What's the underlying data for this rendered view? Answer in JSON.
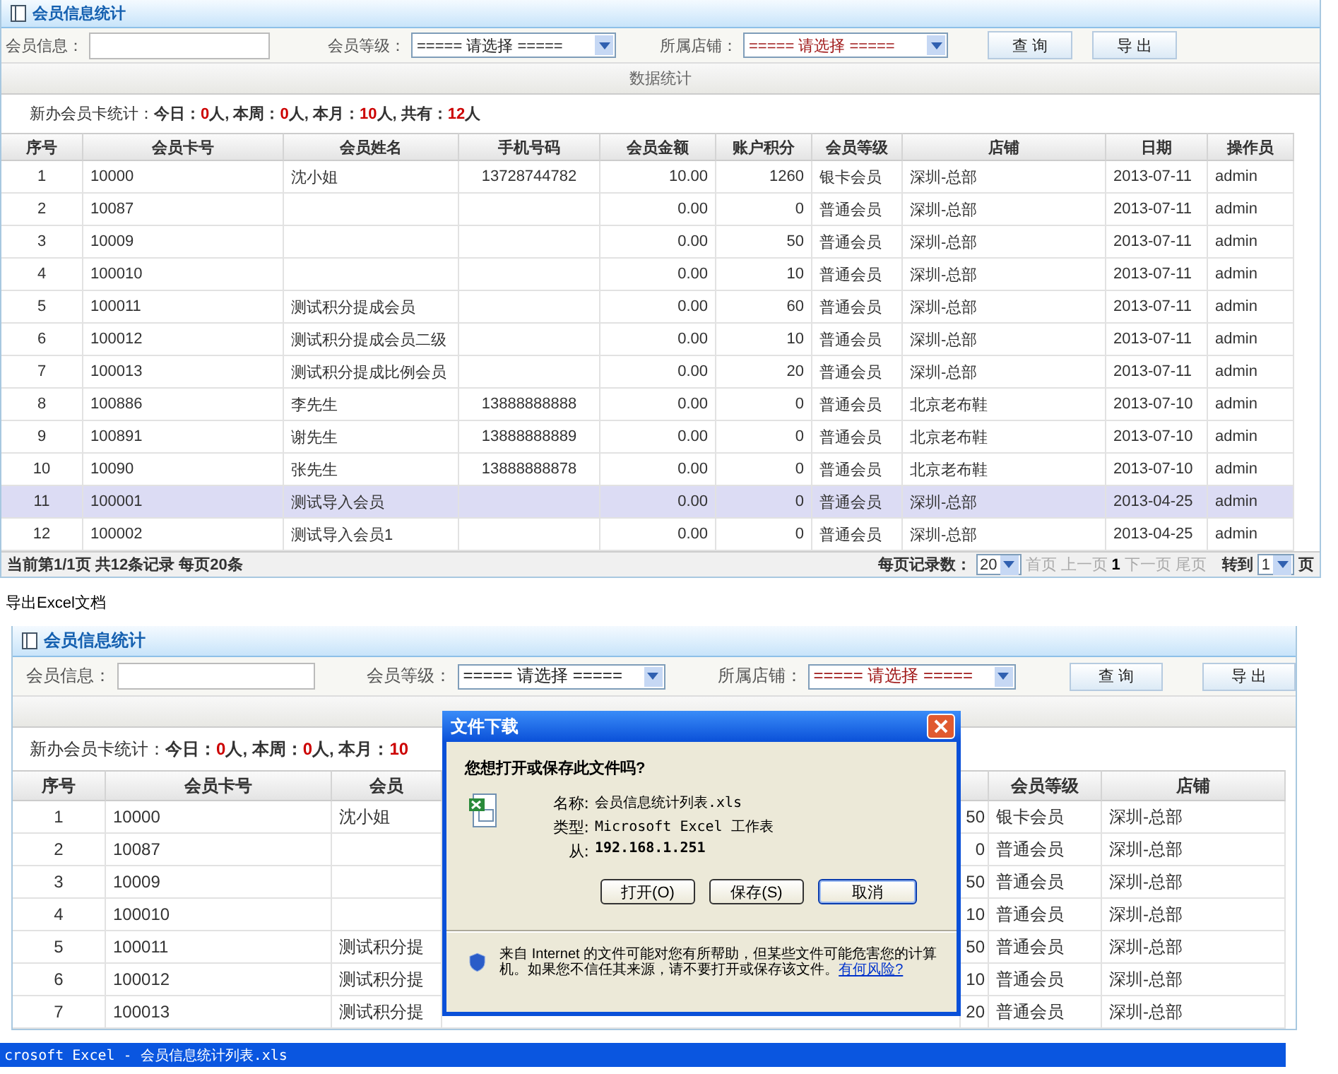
{
  "top_panel": {
    "title": "会员信息统计",
    "filters": [
      {
        "label": "会员信息：",
        "kind": "input"
      },
      {
        "label": "会员等级：",
        "kind": "select",
        "value": "===== 请选择 =====",
        "color": "#222222"
      },
      {
        "label": "所属店铺：",
        "kind": "select",
        "value": "===== 请选择 =====",
        "color": "#a01818"
      }
    ],
    "buttons": [
      "查 询",
      "导 出"
    ],
    "stats_bar": "数据统计",
    "summary": [
      {
        "text": "新办会员卡统计：",
        "kind": "plain"
      },
      {
        "text": "今日：",
        "kind": "key"
      },
      {
        "text": "0",
        "kind": "count"
      },
      {
        "text": "人, 本周：",
        "kind": "key"
      },
      {
        "text": "0",
        "kind": "count"
      },
      {
        "text": "人, 本月：",
        "kind": "key"
      },
      {
        "text": "10",
        "kind": "count"
      },
      {
        "text": "人, 共有：",
        "kind": "key"
      },
      {
        "text": "12",
        "kind": "count"
      },
      {
        "text": "人",
        "kind": "key"
      }
    ],
    "columns": [
      "序号",
      "会员卡号",
      "会员姓名",
      "手机号码",
      "会员金额",
      "账户积分",
      "会员等级",
      "店铺",
      "日期",
      "操作员"
    ],
    "rows": [
      {
        "selected": false,
        "cells": [
          "1",
          "10000",
          "沈小姐",
          "13728744782",
          "10.00",
          "1260",
          "银卡会员",
          "深圳-总部",
          "2013-07-11",
          "admin"
        ]
      },
      {
        "selected": false,
        "cells": [
          "2",
          "10087",
          "",
          "",
          "0.00",
          "0",
          "普通会员",
          "深圳-总部",
          "2013-07-11",
          "admin"
        ]
      },
      {
        "selected": false,
        "cells": [
          "3",
          "10009",
          "",
          "",
          "0.00",
          "50",
          "普通会员",
          "深圳-总部",
          "2013-07-11",
          "admin"
        ]
      },
      {
        "selected": false,
        "cells": [
          "4",
          "100010",
          "",
          "",
          "0.00",
          "10",
          "普通会员",
          "深圳-总部",
          "2013-07-11",
          "admin"
        ]
      },
      {
        "selected": false,
        "cells": [
          "5",
          "100011",
          "测试积分提成会员",
          "",
          "0.00",
          "60",
          "普通会员",
          "深圳-总部",
          "2013-07-11",
          "admin"
        ]
      },
      {
        "selected": false,
        "cells": [
          "6",
          "100012",
          "测试积分提成会员二级",
          "",
          "0.00",
          "10",
          "普通会员",
          "深圳-总部",
          "2013-07-11",
          "admin"
        ]
      },
      {
        "selected": false,
        "cells": [
          "7",
          "100013",
          "测试积分提成比例会员",
          "",
          "0.00",
          "20",
          "普通会员",
          "深圳-总部",
          "2013-07-11",
          "admin"
        ]
      },
      {
        "selected": false,
        "cells": [
          "8",
          "100886",
          "李先生",
          "13888888888",
          "0.00",
          "0",
          "普通会员",
          "北京老布鞋",
          "2013-07-10",
          "admin"
        ]
      },
      {
        "selected": false,
        "cells": [
          "9",
          "100891",
          "谢先生",
          "13888888889",
          "0.00",
          "0",
          "普通会员",
          "北京老布鞋",
          "2013-07-10",
          "admin"
        ]
      },
      {
        "selected": false,
        "cells": [
          "10",
          "10090",
          "张先生",
          "13888888878",
          "0.00",
          "0",
          "普通会员",
          "北京老布鞋",
          "2013-07-10",
          "admin"
        ]
      },
      {
        "selected": true,
        "cells": [
          "11",
          "100001",
          "测试导入会员",
          "",
          "0.00",
          "0",
          "普通会员",
          "深圳-总部",
          "2013-04-25",
          "admin"
        ]
      },
      {
        "selected": false,
        "cells": [
          "12",
          "100002",
          "测试导入会员1",
          "",
          "0.00",
          "0",
          "普通会员",
          "深圳-总部",
          "2013-04-25",
          "admin"
        ]
      }
    ],
    "footer": {
      "info": "当前第1/1页 共12条记录 每页20条",
      "per_page_label": "每页记录数：",
      "per_page": "20",
      "pager": [
        {
          "text": "首页",
          "disabled": true
        },
        {
          "text": "上一页",
          "disabled": true
        },
        {
          "text": "1",
          "disabled": false
        },
        {
          "text": "下一页",
          "disabled": true
        },
        {
          "text": "尾页",
          "disabled": true
        }
      ],
      "goto_label": "转到",
      "goto_page": "1",
      "page_unit": "页"
    }
  },
  "caption": "导出Excel文档",
  "bottom_panel": {
    "title": "会员信息统计",
    "filters": [
      {
        "label": "会员信息：",
        "kind": "input"
      },
      {
        "label": "会员等级：",
        "kind": "select",
        "value": "===== 请选择 =====",
        "color": "#222222"
      },
      {
        "label": "所属店铺：",
        "kind": "select",
        "value": "===== 请选择 =====",
        "color": "#a01818"
      }
    ],
    "buttons": [
      "查 询",
      "导 出"
    ],
    "summary": [
      {
        "text": "新办会员卡统计：",
        "kind": "plain"
      },
      {
        "text": "今日：",
        "kind": "key"
      },
      {
        "text": "0",
        "kind": "count"
      },
      {
        "text": "人, 本周：",
        "kind": "key"
      },
      {
        "text": "0",
        "kind": "count"
      },
      {
        "text": "人, 本月：",
        "kind": "key"
      },
      {
        "text": "10",
        "kind": "count"
      }
    ],
    "columns": [
      "序号",
      "会员卡号",
      "会员",
      "",
      "会员等级",
      "店铺"
    ],
    "rows": [
      [
        "1",
        "10000",
        "沈小姐",
        "50",
        "银卡会员",
        "深圳-总部"
      ],
      [
        "2",
        "10087",
        "",
        "0",
        "普通会员",
        "深圳-总部"
      ],
      [
        "3",
        "10009",
        "",
        "50",
        "普通会员",
        "深圳-总部"
      ],
      [
        "4",
        "100010",
        "",
        "10",
        "普通会员",
        "深圳-总部"
      ],
      [
        "5",
        "100011",
        "测试积分提",
        "50",
        "普通会员",
        "深圳-总部"
      ],
      [
        "6",
        "100012",
        "测试积分提",
        "10",
        "普通会员",
        "深圳-总部"
      ],
      [
        "7",
        "100013",
        "测试积分提",
        "20",
        "普通会员",
        "深圳-总部"
      ]
    ]
  },
  "dialog": {
    "title": "文件下载",
    "question": "您想打开或保存此文件吗?",
    "fields": [
      {
        "label": "名称:",
        "value": "会员信息统计列表.xls",
        "bold": false
      },
      {
        "label": "类型:",
        "value": "Microsoft Excel 工作表",
        "bold": false
      },
      {
        "label": "从:",
        "value": "192.168.1.251",
        "bold": true
      }
    ],
    "buttons": [
      {
        "text": "打开(O)",
        "default": false
      },
      {
        "text": "保存(S)",
        "default": false
      },
      {
        "text": "取消",
        "default": true
      }
    ],
    "warning": "来自 Internet 的文件可能对您有所帮助，但某些文件可能危害您的计算机。如果您不信任其来源，请不要打开或保存该文件。",
    "link": "有何风险?"
  },
  "taskbar": {
    "title": "crosoft Excel - 会员信息统计列表.xls"
  }
}
